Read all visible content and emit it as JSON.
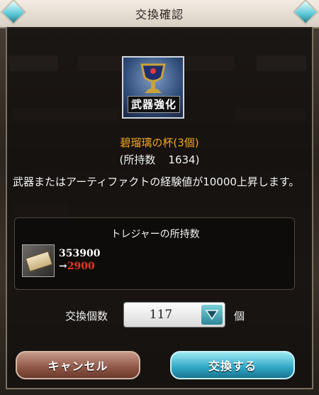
{
  "dialog": {
    "title": "交換確認"
  },
  "item": {
    "icon": "silver-chalice-icon",
    "badge": "武器強化",
    "name": "碧瑠璃の杯(3個)",
    "owned_label": "(所持数",
    "owned_value": "1634)"
  },
  "description": "武器またはアーティファクトの経験値が10000上昇します。",
  "treasure": {
    "heading": "トレジャーの所持数",
    "icon": "ticket-icon",
    "current": "353900",
    "arrow": "→",
    "after": "2900"
  },
  "quantity": {
    "label": "交換個数",
    "value": "117",
    "unit": "個"
  },
  "buttons": {
    "cancel": "キャンセル",
    "exchange": "交換する"
  },
  "colors": {
    "item_name": "#f5a623",
    "after_value": "#e8381f",
    "exchange_button": "#2fa6c4",
    "cancel_button": "#8e5646"
  }
}
